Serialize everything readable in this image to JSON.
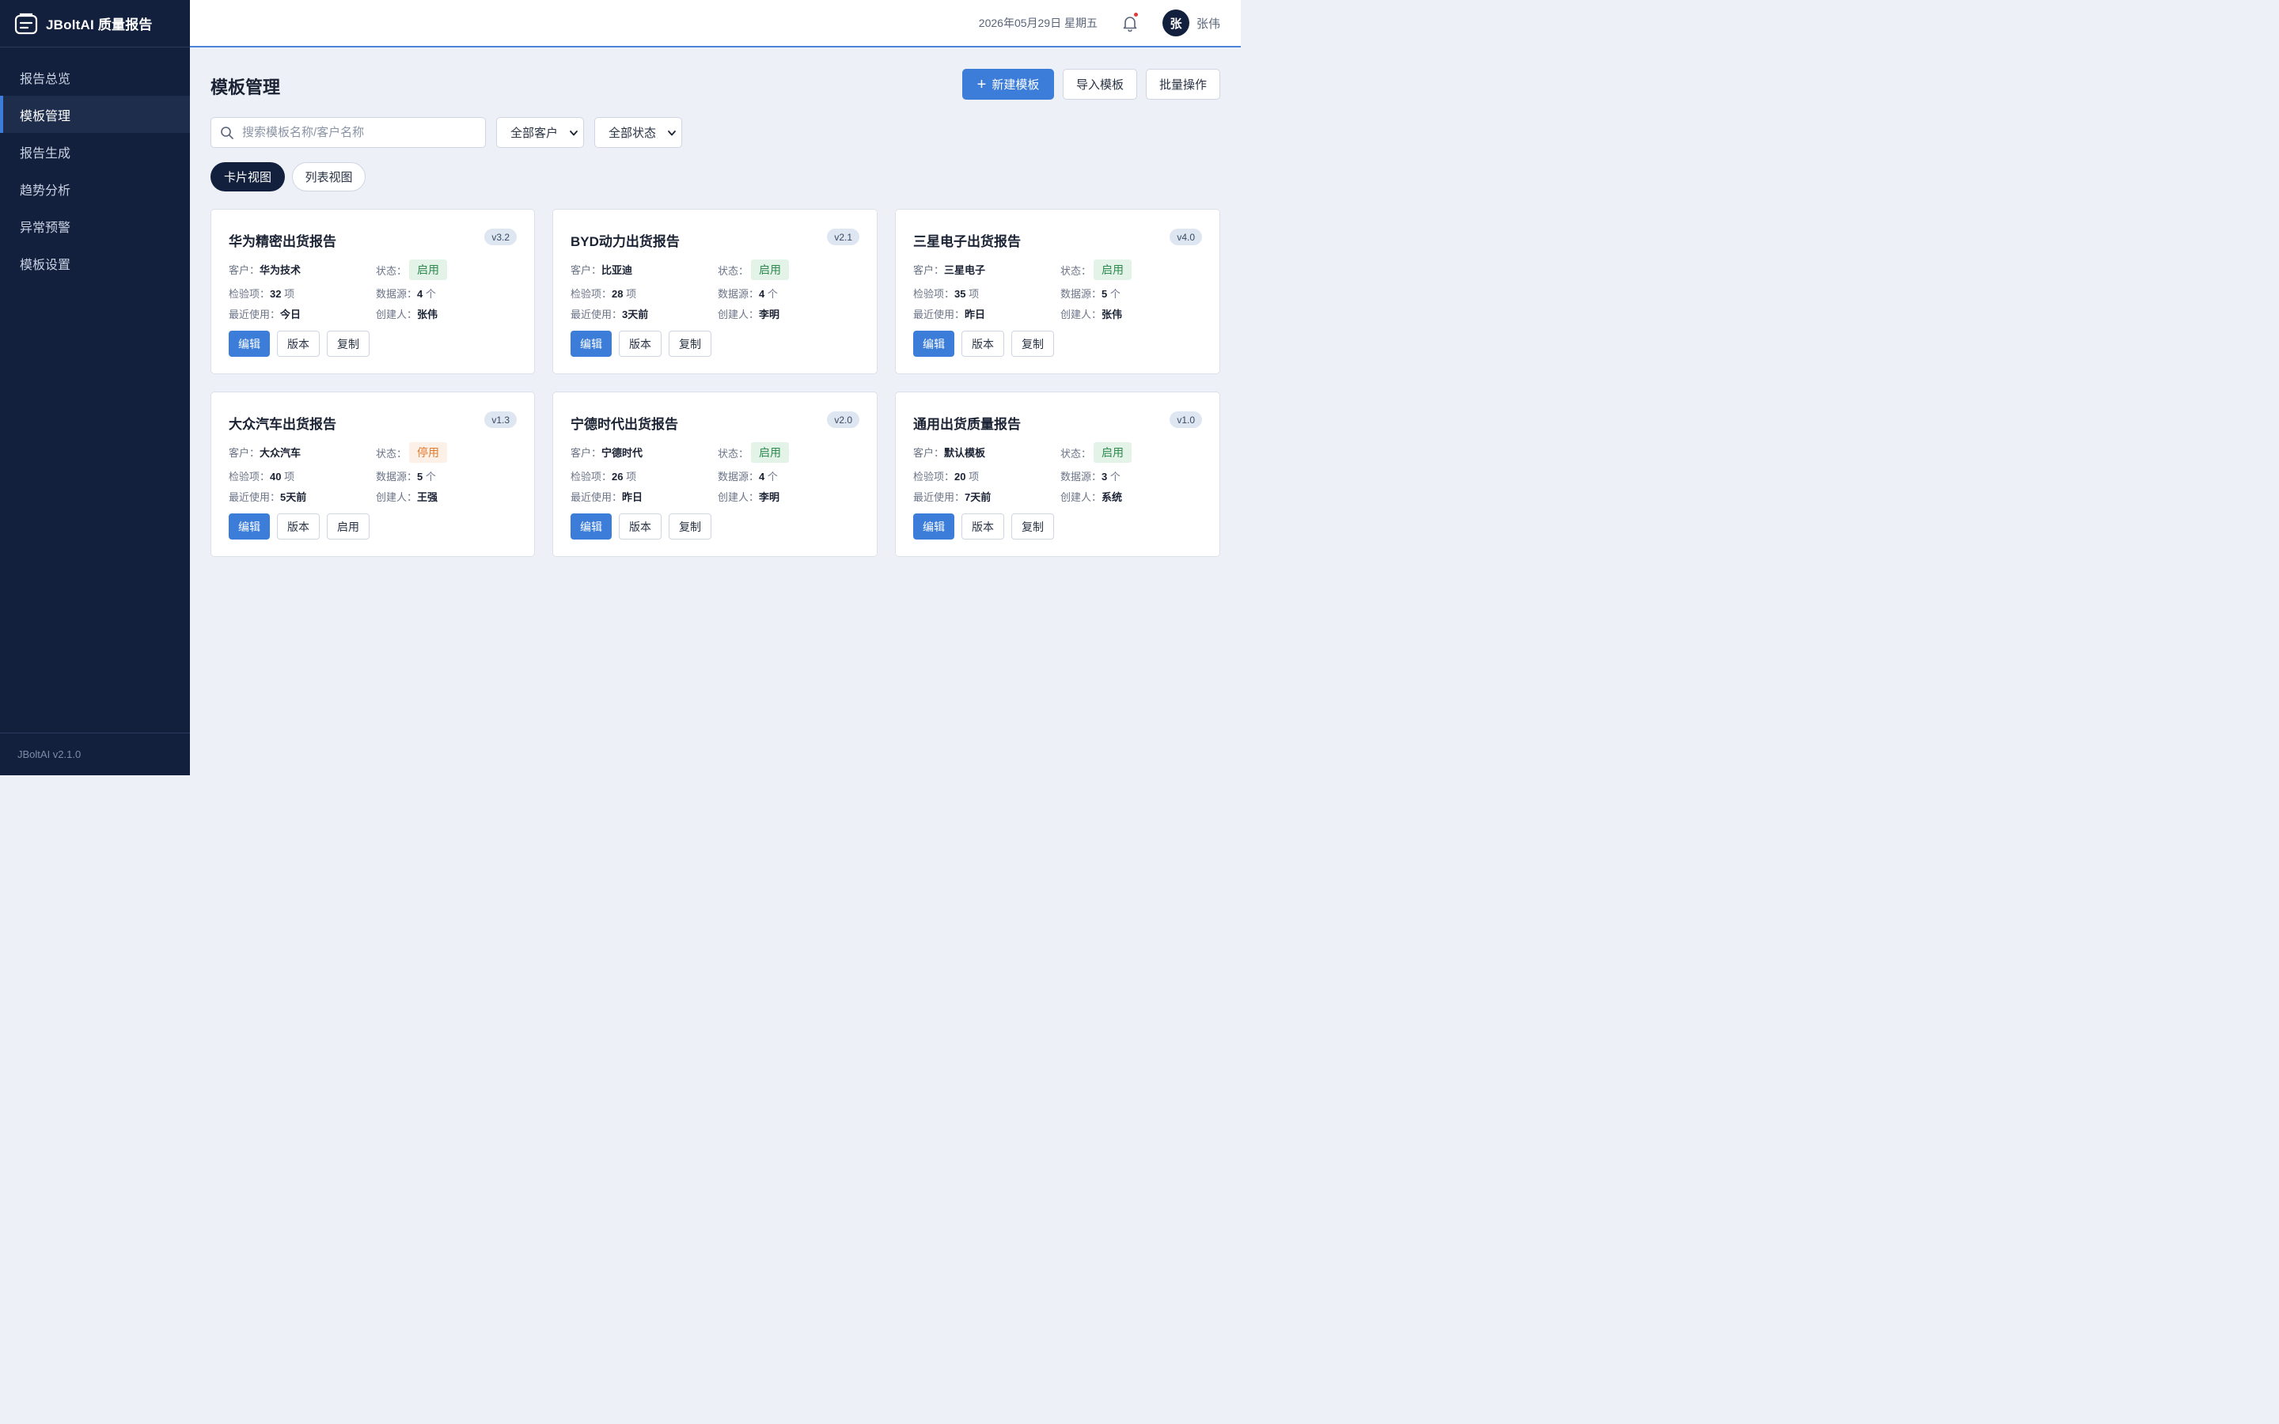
{
  "app": {
    "brand_title": "JBoltAI 质量报告",
    "version_footer": "JBoltAI v2.1.0"
  },
  "sidebar": {
    "items": [
      {
        "label": "报告总览",
        "active": false
      },
      {
        "label": "模板管理",
        "active": true
      },
      {
        "label": "报告生成",
        "active": false
      },
      {
        "label": "趋势分析",
        "active": false
      },
      {
        "label": "异常预警",
        "active": false
      },
      {
        "label": "模板设置",
        "active": false
      }
    ]
  },
  "topbar": {
    "date": "2026年05月29日 星期五",
    "avatar_initial": "张",
    "username": "张伟"
  },
  "page": {
    "title": "模板管理",
    "actions": {
      "new_template": "新建模板",
      "import_template": "导入模板",
      "batch_ops": "批量操作"
    },
    "search": {
      "placeholder": "搜索模板名称/客户名称",
      "value": ""
    },
    "filter_customer": "全部客户",
    "filter_status": "全部状态",
    "view_card": "卡片视图",
    "view_list": "列表视图"
  },
  "labels": {
    "customer": "客户：",
    "status": "状态：",
    "inspection_items": "检验项：",
    "data_sources": "数据源：",
    "last_used": "最近使用：",
    "creator": "创建人：",
    "unit_items": "项",
    "unit_sources": "个"
  },
  "cards": [
    {
      "title": "华为精密出货报告",
      "version": "v3.2",
      "customer": "华为技术",
      "status": "启用",
      "status_type": "on",
      "inspection": "32",
      "sources": "4",
      "last_used": "今日",
      "creator": "张伟",
      "btn_edit": "编辑",
      "btn_version": "版本",
      "btn_third": "复制"
    },
    {
      "title": "BYD动力出货报告",
      "version": "v2.1",
      "customer": "比亚迪",
      "status": "启用",
      "status_type": "on",
      "inspection": "28",
      "sources": "4",
      "last_used": "3天前",
      "creator": "李明",
      "btn_edit": "编辑",
      "btn_version": "版本",
      "btn_third": "复制"
    },
    {
      "title": "三星电子出货报告",
      "version": "v4.0",
      "customer": "三星电子",
      "status": "启用",
      "status_type": "on",
      "inspection": "35",
      "sources": "5",
      "last_used": "昨日",
      "creator": "张伟",
      "btn_edit": "编辑",
      "btn_version": "版本",
      "btn_third": "复制"
    },
    {
      "title": "大众汽车出货报告",
      "version": "v1.3",
      "customer": "大众汽车",
      "status": "停用",
      "status_type": "off",
      "inspection": "40",
      "sources": "5",
      "last_used": "5天前",
      "creator": "王强",
      "btn_edit": "编辑",
      "btn_version": "版本",
      "btn_third": "启用"
    },
    {
      "title": "宁德时代出货报告",
      "version": "v2.0",
      "customer": "宁德时代",
      "status": "启用",
      "status_type": "on",
      "inspection": "26",
      "sources": "4",
      "last_used": "昨日",
      "creator": "李明",
      "btn_edit": "编辑",
      "btn_version": "版本",
      "btn_third": "复制"
    },
    {
      "title": "通用出货质量报告",
      "version": "v1.0",
      "customer": "默认模板",
      "status": "启用",
      "status_type": "on",
      "inspection": "20",
      "sources": "3",
      "last_used": "7天前",
      "creator": "系统",
      "btn_edit": "编辑",
      "btn_version": "版本",
      "btn_third": "复制"
    }
  ],
  "colors": {
    "sidebar_bg": "#12203d",
    "accent": "#3b7dd8",
    "status_on": "#2e8a4e",
    "status_off": "#e07b2e",
    "notification_dot": "#e03b3b"
  },
  "icons": {
    "brand": "report-box-icon",
    "notification": "bell-icon",
    "search": "search-icon",
    "dropdown": "chevron-down-icon",
    "add": "plus-icon"
  }
}
